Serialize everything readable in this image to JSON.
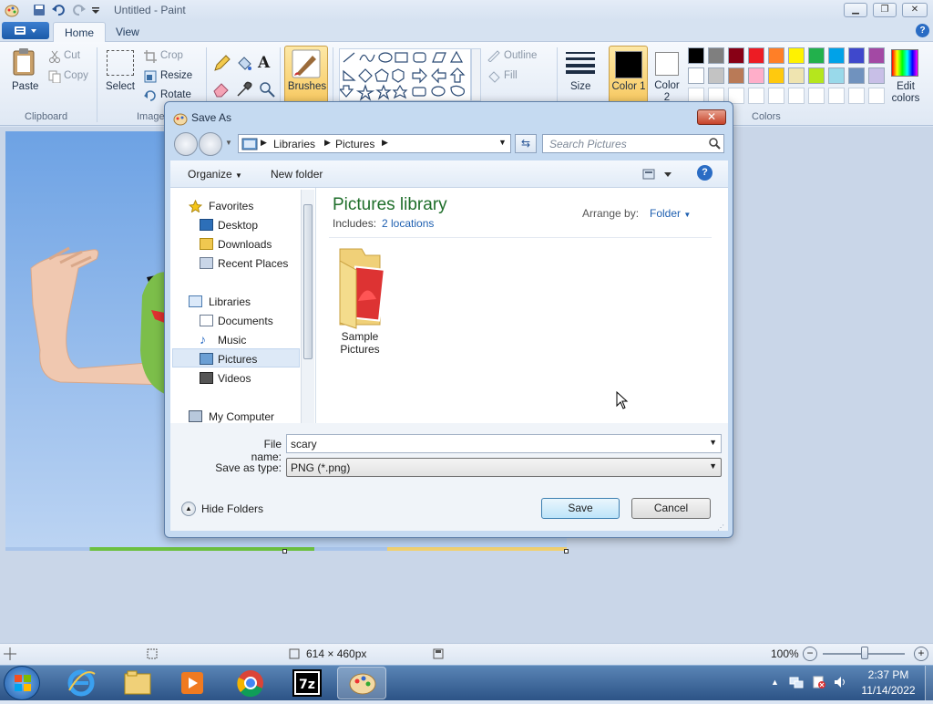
{
  "app": {
    "title": "Untitled - Paint"
  },
  "tabs": [
    {
      "label": "Home"
    },
    {
      "label": "View"
    }
  ],
  "ribbon": {
    "clipboard": {
      "paste": "Paste",
      "cut": "Cut",
      "copy": "Copy",
      "label": "Clipboard"
    },
    "image": {
      "select": "Select",
      "crop": "Crop",
      "resize": "Resize",
      "rotate": "Rotate",
      "label": "Image"
    },
    "brushes": "Brushes",
    "shapes": {
      "outline": "Outline",
      "fill": "Fill"
    },
    "size": "Size",
    "color1": "Color 1",
    "color2": "Color 2",
    "colors_label": "Colors",
    "edit_colors": "Edit colors",
    "palette_row1": [
      "#000000",
      "#7f7f7f",
      "#880015",
      "#ed1c24",
      "#ff7f27",
      "#fff200",
      "#22b14c",
      "#00a2e8",
      "#3f48cc",
      "#a349a4"
    ],
    "palette_row2": [
      "#ffffff",
      "#c3c3c3",
      "#b97a57",
      "#ffaec9",
      "#ffc90e",
      "#efe4b0",
      "#b5e61d",
      "#99d9ea",
      "#7092be",
      "#c8bfe7"
    ]
  },
  "dialog": {
    "title": "Save As",
    "breadcrumb": [
      "Libraries",
      "Pictures"
    ],
    "search_placeholder": "Search Pictures",
    "organize": "Organize",
    "new_folder": "New folder",
    "nav": {
      "favorites": "Favorites",
      "favorites_items": [
        "Desktop",
        "Downloads",
        "Recent Places"
      ],
      "libraries": "Libraries",
      "libraries_items": [
        "Documents",
        "Music",
        "Pictures",
        "Videos"
      ],
      "my_computer": "My Computer"
    },
    "library_title": "Pictures library",
    "includes_label": "Includes:",
    "includes_link": "2 locations",
    "arrange_label": "Arrange by:",
    "arrange_value": "Folder",
    "items": [
      {
        "name": "Sample Pictures"
      }
    ],
    "file_name_label": "File name:",
    "file_name_value": "scary",
    "save_type_label": "Save as type:",
    "save_type_value": "PNG (*.png)",
    "hide_folders": "Hide Folders",
    "save_button": "Save",
    "cancel_button": "Cancel"
  },
  "statusbar": {
    "dimensions": "614 × 460px",
    "zoom": "100%"
  },
  "taskbar": {
    "time": "2:37 PM",
    "date": "11/14/2022"
  }
}
